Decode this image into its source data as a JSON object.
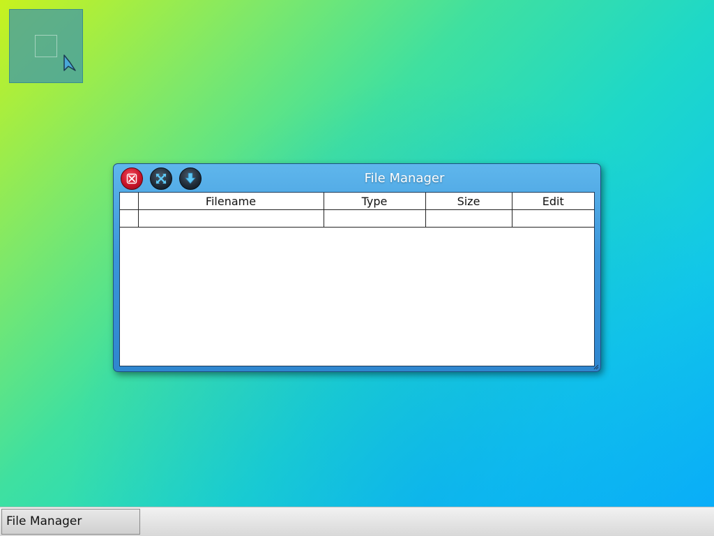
{
  "window": {
    "title": "File Manager",
    "buttons": {
      "close_icon": "close-icon",
      "maximize_icon": "maximize-icon",
      "minimize_icon": "minimize-icon"
    }
  },
  "file_table": {
    "columns": [
      "",
      "Filename",
      "Type",
      "Size",
      "Edit"
    ],
    "rows": [
      [
        "",
        "",
        "",
        "",
        ""
      ]
    ]
  },
  "taskbar": {
    "tasks": [
      {
        "label": "File Manager"
      }
    ]
  },
  "colors": {
    "close_button": "#c8142a",
    "titlebar": "#3a95da"
  }
}
